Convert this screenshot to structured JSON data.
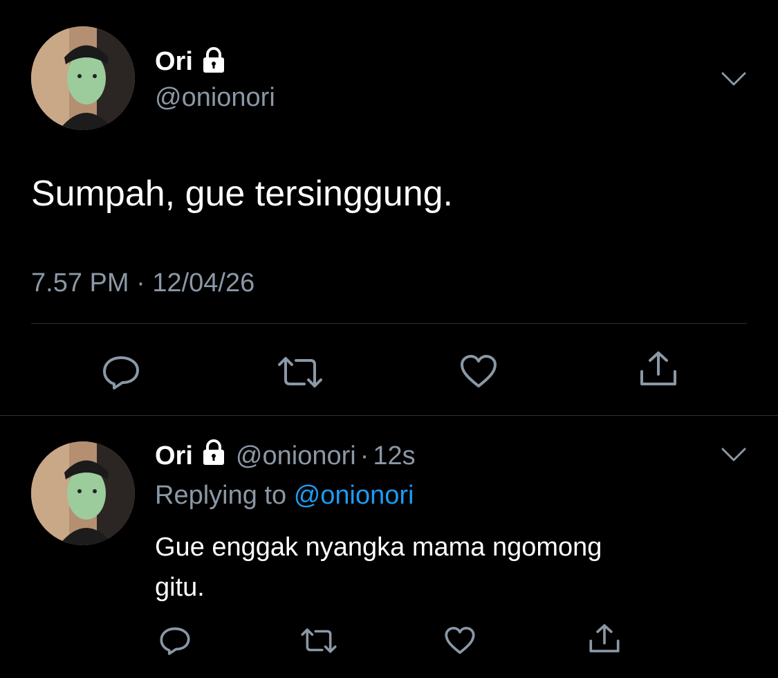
{
  "main_tweet": {
    "name": "Ori",
    "handle": "@onionori",
    "text": "Sumpah, gue tersinggung.",
    "time": "7.57 PM",
    "separator": "·",
    "date": "12/04/26"
  },
  "reply_tweet": {
    "name": "Ori",
    "handle": "@onionori",
    "separator": "·",
    "age": "12s",
    "replying_label": "Replying to",
    "replying_handle": "@onionori",
    "text_line1": "Gue enggak nyangka mama ngomong",
    "text_line2": "gitu."
  },
  "icons": {
    "lock": "lock-icon",
    "chevron": "chevron-down-icon",
    "reply": "reply-icon",
    "retweet": "retweet-icon",
    "like": "heart-icon",
    "share": "share-icon"
  },
  "colors": {
    "background": "#000000",
    "muted": "#8b98a5",
    "link": "#1d9bf0",
    "divider": "#2f3336"
  }
}
